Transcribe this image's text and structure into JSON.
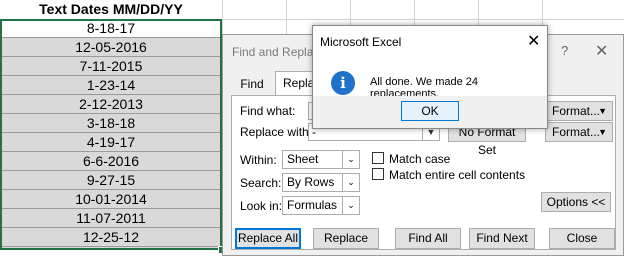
{
  "sheet": {
    "column_header": "Text Dates MM/DD/YY",
    "dates": [
      "8-18-17",
      "12-05-2016",
      "7-11-2015",
      "1-23-14",
      "2-12-2013",
      "3-18-18",
      "4-19-17",
      "6-6-2016",
      "9-27-15",
      "10-01-2014",
      "11-07-2011",
      "12-25-12"
    ]
  },
  "find_replace": {
    "title": "Find and Replace",
    "help_glyph": "?",
    "close_glyph": "✕",
    "tabs": [
      "Find",
      "Replace"
    ],
    "find_what_label": "Find what:",
    "replace_with_label": "Replace with:",
    "replace_with_value": "-",
    "no_format_set": "No Format Set",
    "format_label": "Format...",
    "within_label": "Within:",
    "within_value": "Sheet",
    "search_label": "Search:",
    "search_value": "By Rows",
    "look_in_label": "Look in:",
    "look_in_value": "Formulas",
    "match_case": "Match case",
    "match_entire": "Match entire cell contents",
    "options_button": "Options <<",
    "buttons": {
      "replace_all": "Replace All",
      "replace": "Replace",
      "find_all": "Find All",
      "find_next": "Find Next",
      "close": "Close"
    }
  },
  "message_box": {
    "title": "Microsoft Excel",
    "close_glyph": "✕",
    "icon": "info-icon",
    "text": "All done. We made 24 replacements.",
    "ok": "OK"
  }
}
